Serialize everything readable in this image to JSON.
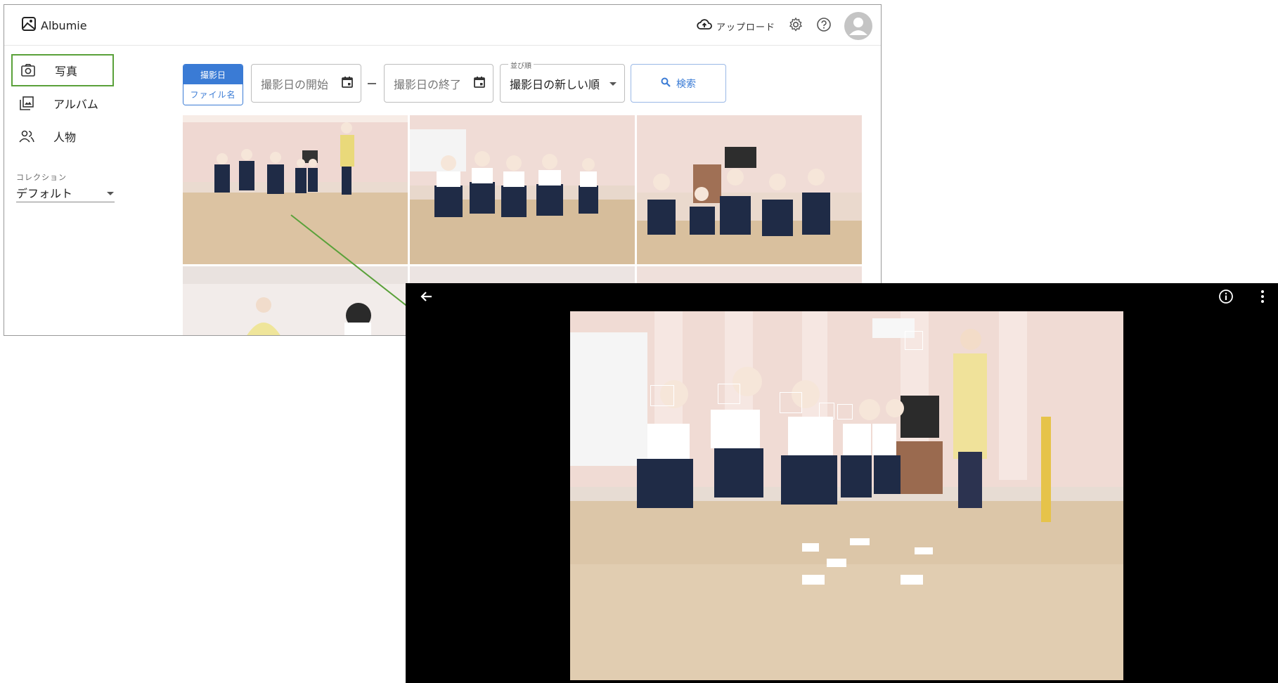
{
  "app": {
    "logo_text": "Albumie",
    "upload_label": "アップロード",
    "icons": [
      "photo-logo-icon",
      "cloud-upload-icon",
      "gear-icon",
      "help-icon",
      "account-icon"
    ]
  },
  "sidebar": {
    "items": [
      {
        "label": "写真",
        "icon": "camera-icon",
        "active": true
      },
      {
        "label": "アルバム",
        "icon": "album-icon",
        "active": false
      },
      {
        "label": "人物",
        "icon": "people-icon",
        "active": false
      }
    ],
    "collection_label": "コレクション",
    "collection_value": "デフォルト"
  },
  "filters": {
    "mode_selected": "撮影日",
    "mode_other": "ファイル名",
    "start_placeholder": "撮影日の開始",
    "end_placeholder": "撮影日の終了",
    "sort_label": "並び順",
    "sort_value": "撮影日の新しい順",
    "search_label": "検索"
  },
  "viewer": {
    "background": "#000000",
    "icons": [
      "arrow-back-icon",
      "info-icon",
      "more-vert-icon"
    ]
  },
  "colors": {
    "accent": "#3a7bd5",
    "highlight": "#5aa13a"
  }
}
